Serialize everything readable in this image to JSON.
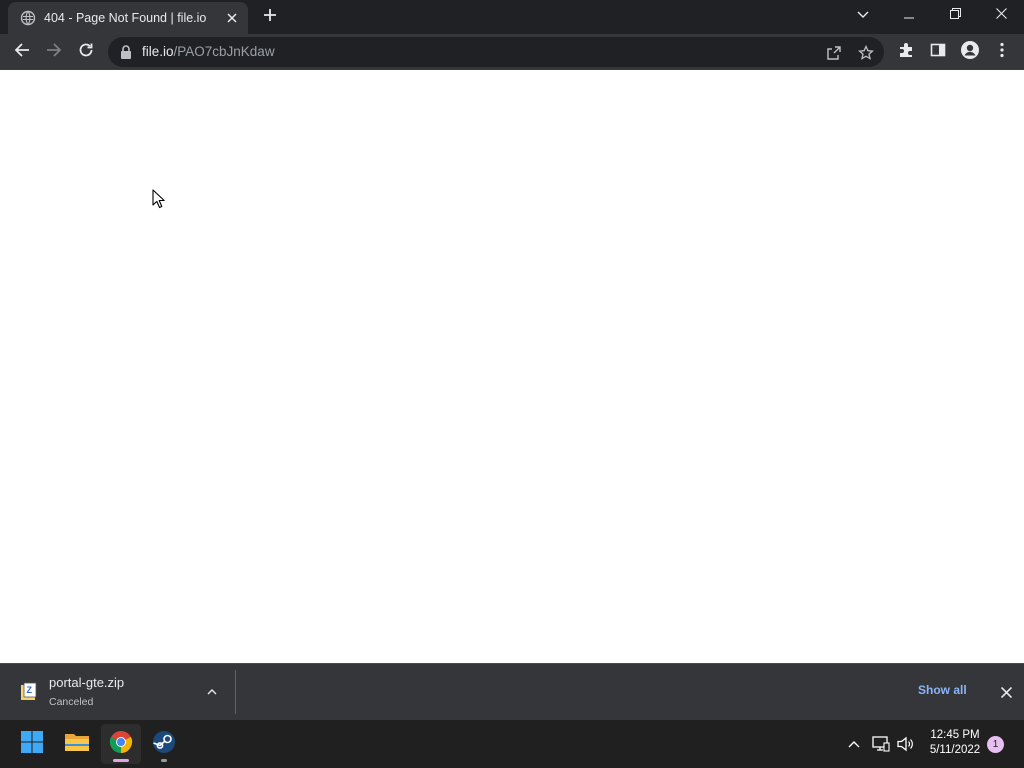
{
  "browser": {
    "tab": {
      "title": "404 - Page Not Found | file.io",
      "favicon": "globe-icon"
    },
    "new_tab_icon": "plus-icon",
    "tab_search_icon": "chevron-down-icon",
    "window_controls": [
      "minimize-icon",
      "restore-icon",
      "close-icon"
    ],
    "address_bar": {
      "host": "file.io",
      "path": "/PAO7cbJnKdaw",
      "secure_icon": "lock-icon"
    },
    "toolbar_icons": [
      "back-icon",
      "forward-icon",
      "reload-icon",
      "share-icon",
      "star-icon",
      "extensions-icon",
      "side-panel-icon",
      "profile-icon",
      "menu-icon"
    ]
  },
  "download_shelf": {
    "item": {
      "file_name": "portal-gte.zip",
      "status": "Canceled",
      "icon": "zip-file-icon"
    },
    "show_all_label": "Show all"
  },
  "taskbar": {
    "apps": [
      "windows-start-icon",
      "file-explorer-icon",
      "chrome-icon",
      "steam-icon"
    ],
    "clock": {
      "time": "12:45 PM",
      "date": "5/11/2022"
    },
    "notification_count": "1"
  },
  "colors": {
    "titlebar": "#202124",
    "toolbar": "#35363a",
    "link_blue": "#8ab4f8",
    "taskbar": "#202020"
  }
}
